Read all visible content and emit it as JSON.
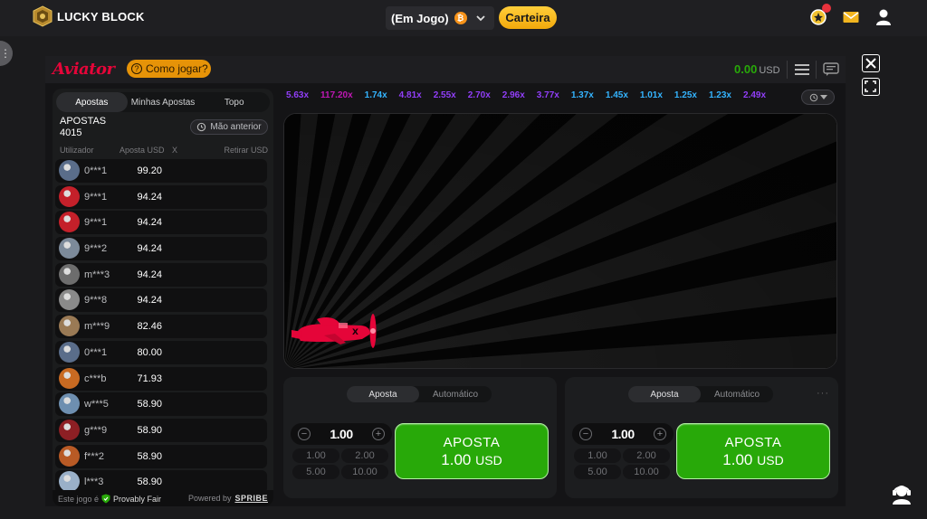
{
  "topbar": {
    "brand": "LUCKY BLOCK",
    "game_status": "(Em Jogo)",
    "wallet_label": "Carteira",
    "icons": [
      "logo-icon",
      "bitcoin-icon",
      "chevron-down-icon",
      "rewards-icon",
      "mail-icon",
      "user-icon"
    ]
  },
  "game": {
    "title": "Aviator",
    "how_to_play": "Como jogar?",
    "balance_amount": "0.00",
    "balance_currency": "USD"
  },
  "bets_panel": {
    "tabs": [
      "Apostas",
      "Minhas Apostas",
      "Topo"
    ],
    "active_tab": "Apostas",
    "count_label": "APOSTAS",
    "count_value": "4015",
    "previous_hand": "Mão anterior",
    "columns": {
      "user": "Utilizador",
      "bet": "Aposta USD",
      "x": "X",
      "cashout": "Retirar USD"
    },
    "rows": [
      {
        "user": "0***1",
        "bet": "99.20",
        "avatar": "#5a6d8a"
      },
      {
        "user": "9***1",
        "bet": "94.24",
        "avatar": "#c4202a"
      },
      {
        "user": "9***1",
        "bet": "94.24",
        "avatar": "#c4202a"
      },
      {
        "user": "9***2",
        "bet": "94.24",
        "avatar": "#7c8a9a"
      },
      {
        "user": "m***3",
        "bet": "94.24",
        "avatar": "#6d6d6d"
      },
      {
        "user": "9***8",
        "bet": "94.24",
        "avatar": "#8a8a8a"
      },
      {
        "user": "m***9",
        "bet": "82.46",
        "avatar": "#9a7a55"
      },
      {
        "user": "0***1",
        "bet": "80.00",
        "avatar": "#5a6d8a"
      },
      {
        "user": "c***b",
        "bet": "71.93",
        "avatar": "#c86a22"
      },
      {
        "user": "w***5",
        "bet": "58.90",
        "avatar": "#6e8fb0"
      },
      {
        "user": "g***9",
        "bet": "58.90",
        "avatar": "#8d1f24"
      },
      {
        "user": "f***2",
        "bet": "58.90",
        "avatar": "#b85a25"
      },
      {
        "user": "l***3",
        "bet": "58.90",
        "avatar": "#9ab0c8"
      }
    ],
    "footer_text": "Este jogo é",
    "provably_fair": "Provably Fair",
    "powered_by": "Powered by",
    "provider": "SPRIBE"
  },
  "multipliers": [
    {
      "v": "5.63x",
      "c": "#913ef8"
    },
    {
      "v": "117.20x",
      "c": "#c017b4"
    },
    {
      "v": "1.74x",
      "c": "#34b4ff"
    },
    {
      "v": "4.81x",
      "c": "#913ef8"
    },
    {
      "v": "2.55x",
      "c": "#913ef8"
    },
    {
      "v": "2.70x",
      "c": "#913ef8"
    },
    {
      "v": "2.96x",
      "c": "#913ef8"
    },
    {
      "v": "3.77x",
      "c": "#913ef8"
    },
    {
      "v": "1.37x",
      "c": "#34b4ff"
    },
    {
      "v": "1.45x",
      "c": "#34b4ff"
    },
    {
      "v": "1.01x",
      "c": "#34b4ff"
    },
    {
      "v": "1.25x",
      "c": "#34b4ff"
    },
    {
      "v": "1.23x",
      "c": "#34b4ff"
    },
    {
      "v": "2.49x",
      "c": "#913ef8"
    }
  ],
  "bet_boxes": [
    {
      "tabs": [
        "Aposta",
        "Automático"
      ],
      "amount": "1.00",
      "quick": [
        "1.00",
        "2.00",
        "5.00",
        "10.00"
      ],
      "place_label": "APOSTA",
      "place_amount": "1.00",
      "place_currency": "USD"
    },
    {
      "tabs": [
        "Aposta",
        "Automático"
      ],
      "amount": "1.00",
      "quick": [
        "1.00",
        "2.00",
        "5.00",
        "10.00"
      ],
      "place_label": "APOSTA",
      "place_amount": "1.00",
      "place_currency": "USD"
    }
  ],
  "colors": {
    "accent_red": "#e50539",
    "bet_green": "#28a909",
    "wallet_yellow": "#f2a90c"
  }
}
